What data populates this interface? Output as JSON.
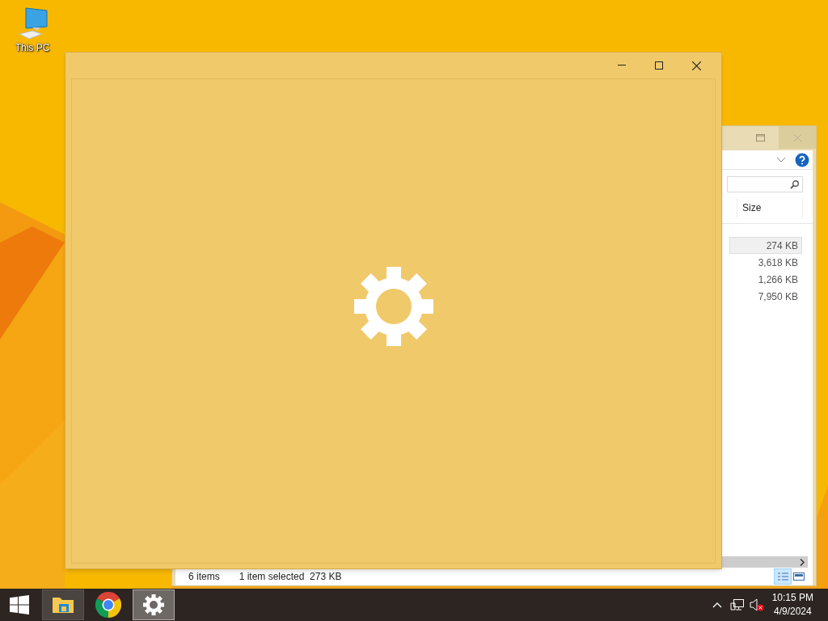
{
  "desktop_icons": [
    {
      "label": "This PC"
    }
  ],
  "explorer": {
    "column_header": "Size",
    "rows": [
      {
        "size": "274 KB",
        "selected": true
      },
      {
        "size": "3,618 KB",
        "selected": false
      },
      {
        "size": "1,266 KB",
        "selected": false
      },
      {
        "size": "7,950 KB",
        "selected": false
      }
    ],
    "status_bar": {
      "items": "6 items",
      "selection": "1 item selected  273 KB"
    }
  },
  "taskbar": {
    "apps": [
      {
        "kind": "explorer",
        "running": true,
        "active": false
      },
      {
        "kind": "chrome",
        "running": false,
        "active": false
      },
      {
        "kind": "settings",
        "running": true,
        "active": true
      }
    ],
    "clock": {
      "time": "10:15 PM",
      "date": "4/9/2024"
    }
  }
}
